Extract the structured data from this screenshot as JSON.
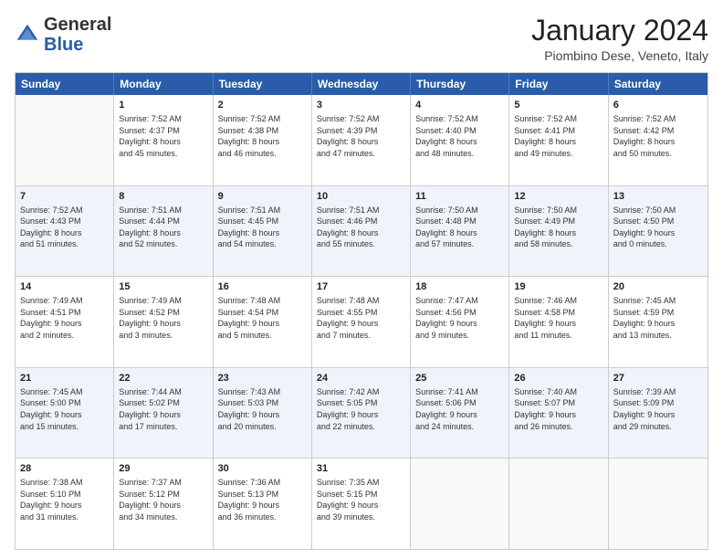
{
  "header": {
    "logo": {
      "general": "General",
      "blue": "Blue"
    },
    "title": "January 2024",
    "subtitle": "Piombino Dese, Veneto, Italy"
  },
  "days": [
    "Sunday",
    "Monday",
    "Tuesday",
    "Wednesday",
    "Thursday",
    "Friday",
    "Saturday"
  ],
  "weeks": [
    [
      {
        "day": "",
        "sunrise": "",
        "sunset": "",
        "daylight": ""
      },
      {
        "day": "1",
        "sunrise": "Sunrise: 7:52 AM",
        "sunset": "Sunset: 4:37 PM",
        "daylight": "Daylight: 8 hours and 45 minutes."
      },
      {
        "day": "2",
        "sunrise": "Sunrise: 7:52 AM",
        "sunset": "Sunset: 4:38 PM",
        "daylight": "Daylight: 8 hours and 46 minutes."
      },
      {
        "day": "3",
        "sunrise": "Sunrise: 7:52 AM",
        "sunset": "Sunset: 4:39 PM",
        "daylight": "Daylight: 8 hours and 47 minutes."
      },
      {
        "day": "4",
        "sunrise": "Sunrise: 7:52 AM",
        "sunset": "Sunset: 4:40 PM",
        "daylight": "Daylight: 8 hours and 48 minutes."
      },
      {
        "day": "5",
        "sunrise": "Sunrise: 7:52 AM",
        "sunset": "Sunset: 4:41 PM",
        "daylight": "Daylight: 8 hours and 49 minutes."
      },
      {
        "day": "6",
        "sunrise": "Sunrise: 7:52 AM",
        "sunset": "Sunset: 4:42 PM",
        "daylight": "Daylight: 8 hours and 50 minutes."
      }
    ],
    [
      {
        "day": "7",
        "sunrise": "Sunrise: 7:52 AM",
        "sunset": "Sunset: 4:43 PM",
        "daylight": "Daylight: 8 hours and 51 minutes."
      },
      {
        "day": "8",
        "sunrise": "Sunrise: 7:51 AM",
        "sunset": "Sunset: 4:44 PM",
        "daylight": "Daylight: 8 hours and 52 minutes."
      },
      {
        "day": "9",
        "sunrise": "Sunrise: 7:51 AM",
        "sunset": "Sunset: 4:45 PM",
        "daylight": "Daylight: 8 hours and 54 minutes."
      },
      {
        "day": "10",
        "sunrise": "Sunrise: 7:51 AM",
        "sunset": "Sunset: 4:46 PM",
        "daylight": "Daylight: 8 hours and 55 minutes."
      },
      {
        "day": "11",
        "sunrise": "Sunrise: 7:50 AM",
        "sunset": "Sunset: 4:48 PM",
        "daylight": "Daylight: 8 hours and 57 minutes."
      },
      {
        "day": "12",
        "sunrise": "Sunrise: 7:50 AM",
        "sunset": "Sunset: 4:49 PM",
        "daylight": "Daylight: 8 hours and 58 minutes."
      },
      {
        "day": "13",
        "sunrise": "Sunrise: 7:50 AM",
        "sunset": "Sunset: 4:50 PM",
        "daylight": "Daylight: 9 hours and 0 minutes."
      }
    ],
    [
      {
        "day": "14",
        "sunrise": "Sunrise: 7:49 AM",
        "sunset": "Sunset: 4:51 PM",
        "daylight": "Daylight: 9 hours and 2 minutes."
      },
      {
        "day": "15",
        "sunrise": "Sunrise: 7:49 AM",
        "sunset": "Sunset: 4:52 PM",
        "daylight": "Daylight: 9 hours and 3 minutes."
      },
      {
        "day": "16",
        "sunrise": "Sunrise: 7:48 AM",
        "sunset": "Sunset: 4:54 PM",
        "daylight": "Daylight: 9 hours and 5 minutes."
      },
      {
        "day": "17",
        "sunrise": "Sunrise: 7:48 AM",
        "sunset": "Sunset: 4:55 PM",
        "daylight": "Daylight: 9 hours and 7 minutes."
      },
      {
        "day": "18",
        "sunrise": "Sunrise: 7:47 AM",
        "sunset": "Sunset: 4:56 PM",
        "daylight": "Daylight: 9 hours and 9 minutes."
      },
      {
        "day": "19",
        "sunrise": "Sunrise: 7:46 AM",
        "sunset": "Sunset: 4:58 PM",
        "daylight": "Daylight: 9 hours and 11 minutes."
      },
      {
        "day": "20",
        "sunrise": "Sunrise: 7:45 AM",
        "sunset": "Sunset: 4:59 PM",
        "daylight": "Daylight: 9 hours and 13 minutes."
      }
    ],
    [
      {
        "day": "21",
        "sunrise": "Sunrise: 7:45 AM",
        "sunset": "Sunset: 5:00 PM",
        "daylight": "Daylight: 9 hours and 15 minutes."
      },
      {
        "day": "22",
        "sunrise": "Sunrise: 7:44 AM",
        "sunset": "Sunset: 5:02 PM",
        "daylight": "Daylight: 9 hours and 17 minutes."
      },
      {
        "day": "23",
        "sunrise": "Sunrise: 7:43 AM",
        "sunset": "Sunset: 5:03 PM",
        "daylight": "Daylight: 9 hours and 20 minutes."
      },
      {
        "day": "24",
        "sunrise": "Sunrise: 7:42 AM",
        "sunset": "Sunset: 5:05 PM",
        "daylight": "Daylight: 9 hours and 22 minutes."
      },
      {
        "day": "25",
        "sunrise": "Sunrise: 7:41 AM",
        "sunset": "Sunset: 5:06 PM",
        "daylight": "Daylight: 9 hours and 24 minutes."
      },
      {
        "day": "26",
        "sunrise": "Sunrise: 7:40 AM",
        "sunset": "Sunset: 5:07 PM",
        "daylight": "Daylight: 9 hours and 26 minutes."
      },
      {
        "day": "27",
        "sunrise": "Sunrise: 7:39 AM",
        "sunset": "Sunset: 5:09 PM",
        "daylight": "Daylight: 9 hours and 29 minutes."
      }
    ],
    [
      {
        "day": "28",
        "sunrise": "Sunrise: 7:38 AM",
        "sunset": "Sunset: 5:10 PM",
        "daylight": "Daylight: 9 hours and 31 minutes."
      },
      {
        "day": "29",
        "sunrise": "Sunrise: 7:37 AM",
        "sunset": "Sunset: 5:12 PM",
        "daylight": "Daylight: 9 hours and 34 minutes."
      },
      {
        "day": "30",
        "sunrise": "Sunrise: 7:36 AM",
        "sunset": "Sunset: 5:13 PM",
        "daylight": "Daylight: 9 hours and 36 minutes."
      },
      {
        "day": "31",
        "sunrise": "Sunrise: 7:35 AM",
        "sunset": "Sunset: 5:15 PM",
        "daylight": "Daylight: 9 hours and 39 minutes."
      },
      {
        "day": "",
        "sunrise": "",
        "sunset": "",
        "daylight": ""
      },
      {
        "day": "",
        "sunrise": "",
        "sunset": "",
        "daylight": ""
      },
      {
        "day": "",
        "sunrise": "",
        "sunset": "",
        "daylight": ""
      }
    ]
  ]
}
